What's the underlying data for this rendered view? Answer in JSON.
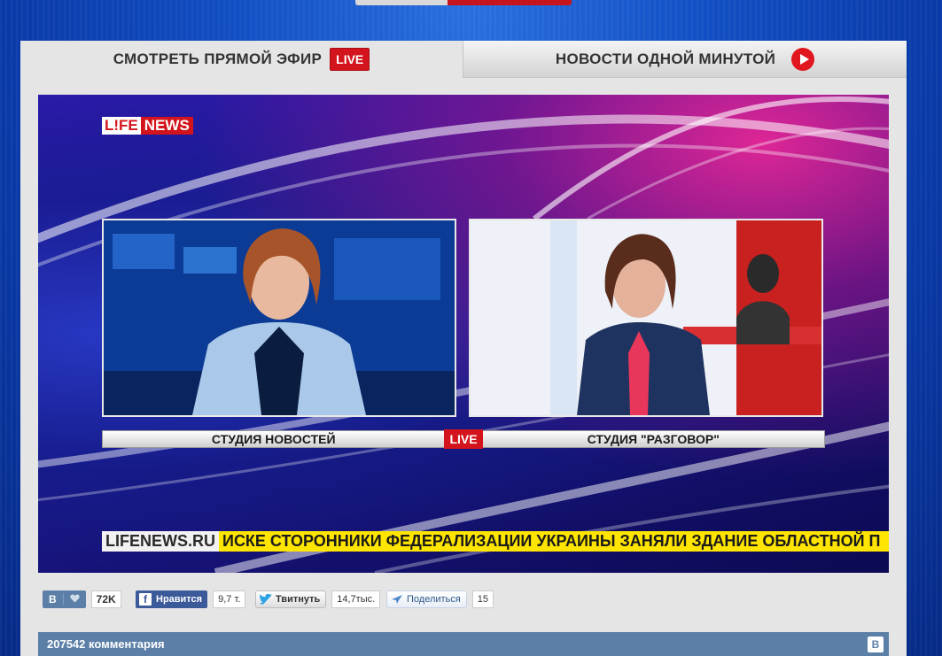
{
  "tabs": {
    "live_label": "СМОТРЕТЬ ПРЯМОЙ ЭФИР",
    "live_badge": "LIVE",
    "news_label": "НОВОСТИ ОДНОЙ МИНУТОЙ"
  },
  "player": {
    "logo_part1": "L!FE",
    "logo_part2": "NEWS",
    "studio_left": "СТУДИЯ НОВОСТЕЙ",
    "live_mid": "LIVE",
    "studio_right": "СТУДИЯ \"РАЗГОВОР\"",
    "ticker_site": "LIFENEWS.RU",
    "ticker_text": "ИСКЕ СТОРОННИКИ ФЕДЕРАЛИЗАЦИИ УКРАИНЫ ЗАНЯЛИ ЗДАНИЕ ОБЛАСТНОЙ П"
  },
  "social": {
    "vk_label": "В",
    "vk_count": "72K",
    "fb_label": "Нравится",
    "fb_count": "9,7 т.",
    "tw_label": "Твитнуть",
    "tw_count": "14,7тыс.",
    "mr_label": "Поделиться",
    "mr_count": "15"
  },
  "comments": {
    "title": "207542 комментария",
    "vk_icon_label": "В"
  },
  "colors": {
    "accent_red": "#d3141c",
    "vk_blue": "#5c7fa8",
    "fb_blue": "#3b5a9a",
    "ticker_yellow": "#ffe500"
  },
  "icons": [
    "heart-icon",
    "play-icon",
    "facebook-icon",
    "twitter-bird-icon",
    "share-bird-icon",
    "vk-icon"
  ]
}
